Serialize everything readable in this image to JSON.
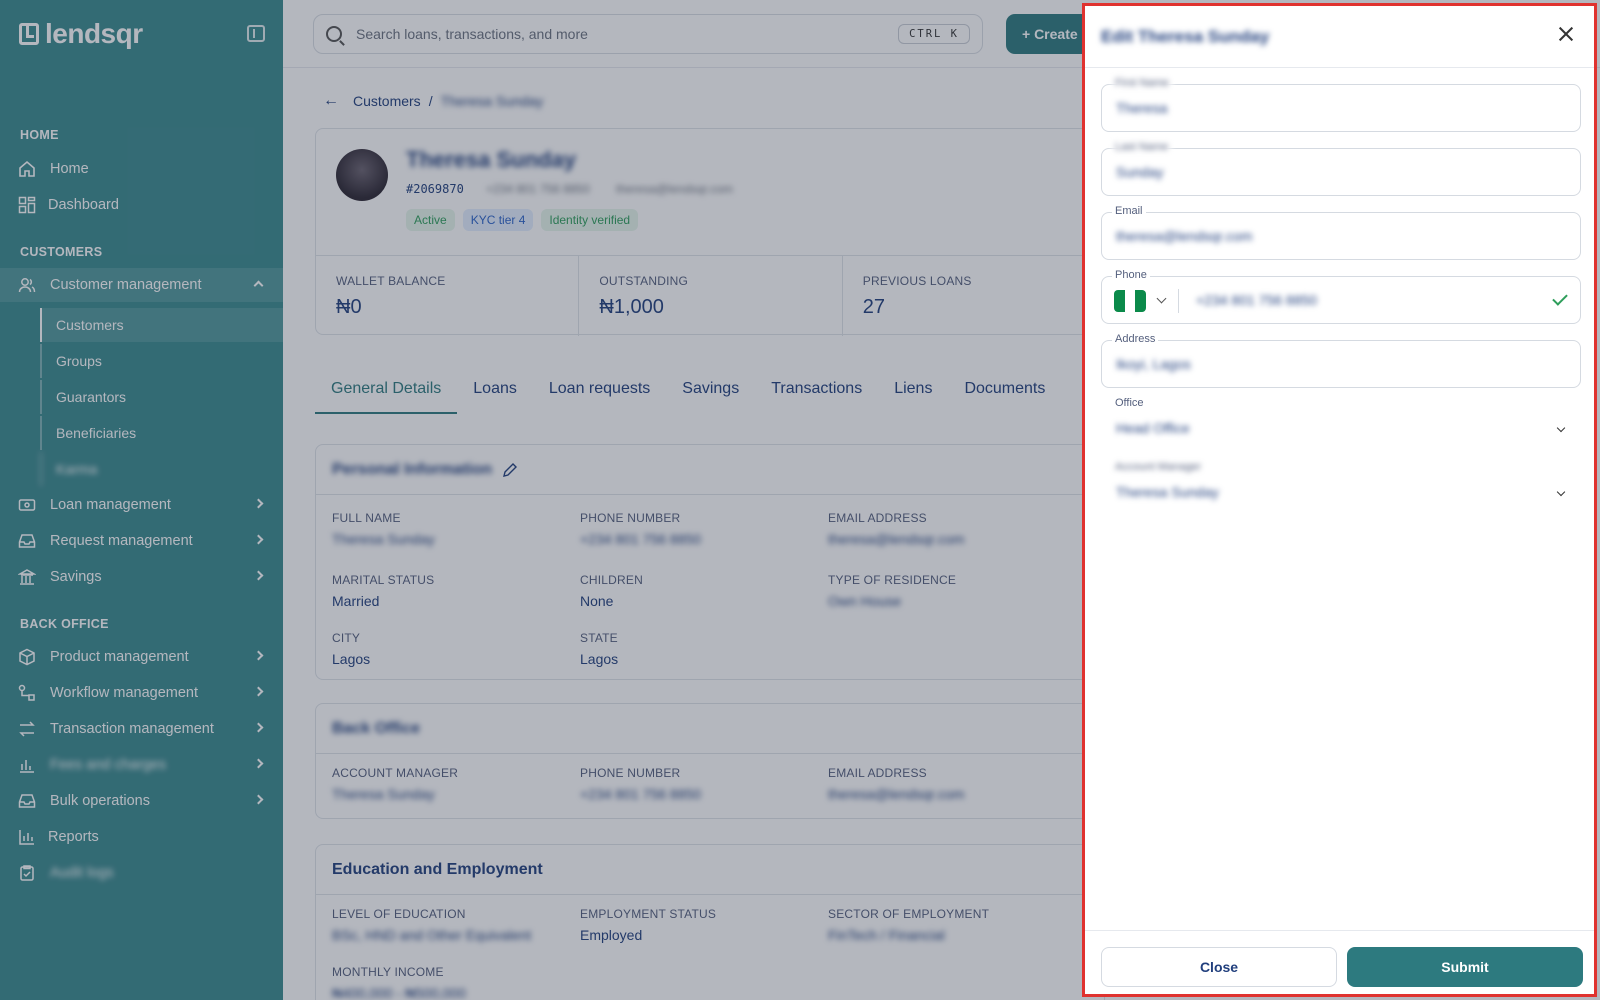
{
  "app": {
    "brand": "lendsqr"
  },
  "sidebar": {
    "sections": {
      "home": "HOME",
      "customers": "CUSTOMERS",
      "back_office": "BACK OFFICE"
    },
    "items": {
      "home": "Home",
      "dashboard": "Dashboard",
      "customer_management": "Customer management",
      "customers": "Customers",
      "groups": "Groups",
      "guarantors": "Guarantors",
      "beneficiaries": "Beneficiaries",
      "blurred_sub": "Karma",
      "loan_management": "Loan management",
      "request_management": "Request management",
      "savings": "Savings",
      "product_management": "Product management",
      "workflow_management": "Workflow management",
      "transaction_management": "Transaction management",
      "blurred_item": "Fees and charges",
      "bulk_operations": "Bulk operations",
      "reports": "Reports",
      "blurred_last": "Audit logs"
    }
  },
  "topbar": {
    "search_placeholder": "Search loans, transactions, and more",
    "shortcut": "CTRL K",
    "create_label": "+ Create"
  },
  "breadcrumb": {
    "parent": "Customers",
    "separator": "/",
    "current": "Theresa Sunday"
  },
  "customer": {
    "name": "Theresa Sunday",
    "id": "#2069870",
    "phone": "+234 801 756 8850",
    "email": "theresa@lendsqr.com",
    "badges": [
      "Active",
      "KYC tier 4",
      "Identity verified"
    ]
  },
  "stats": [
    {
      "label": "WALLET BALANCE",
      "value": "₦0"
    },
    {
      "label": "OUTSTANDING",
      "value": "₦1,000"
    },
    {
      "label": "PREVIOUS LOANS",
      "value": "27"
    }
  ],
  "tabs": [
    "General Details",
    "Loans",
    "Loan requests",
    "Savings",
    "Transactions",
    "Liens",
    "Documents"
  ],
  "personal": {
    "title": "Personal Information",
    "full_name_label": "FULL NAME",
    "full_name": "Theresa Sunday",
    "phone_label": "PHONE NUMBER",
    "phone": "+234 801 756 8850",
    "email_label": "EMAIL ADDRESS",
    "email": "theresa@lendsqr.com",
    "marital_label": "MARITAL STATUS",
    "marital": "Married",
    "children_label": "CHILDREN",
    "children": "None",
    "residence_label": "TYPE OF RESIDENCE",
    "residence": "Own House",
    "city_label": "CITY",
    "city": "Lagos",
    "state_label": "STATE",
    "state": "Lagos"
  },
  "office": {
    "title": "Back Office",
    "manager_label": "ACCOUNT MANAGER",
    "manager": "Theresa Sunday",
    "phone_label": "PHONE NUMBER",
    "phone": "+234 801 756 8850",
    "email_label": "EMAIL ADDRESS",
    "email": "theresa@lendsqr.com"
  },
  "education": {
    "title": "Education and Employment",
    "level_label": "LEVEL OF EDUCATION",
    "level": "BSc, HND and Other Equivalent",
    "status_label": "EMPLOYMENT STATUS",
    "status": "Employed",
    "sector_label": "SECTOR OF EMPLOYMENT",
    "sector": "FinTech / Financial",
    "income_label": "MONTHLY INCOME",
    "income": "₦400,000 - ₦500,000"
  },
  "drawer": {
    "title": "Edit Theresa Sunday",
    "first_name_label": "First Name",
    "first_name": "Theresa",
    "last_name_label": "Last Name",
    "last_name": "Sunday",
    "email_label": "Email",
    "email": "theresa@lendsqr.com",
    "phone_label": "Phone",
    "phone": "+234 801 756 8850",
    "address_label": "Address",
    "address": "Ikoyi, Lagos",
    "office_label": "Office",
    "office": "Head Office",
    "manager_label": "Account Manager",
    "manager": "Theresa Sunday",
    "close_label": "Close",
    "submit_label": "Submit"
  },
  "colors": {
    "sidebar": "#3a8a8e",
    "accent": "#2d7a7f",
    "highlight_border": "#e0322f"
  }
}
